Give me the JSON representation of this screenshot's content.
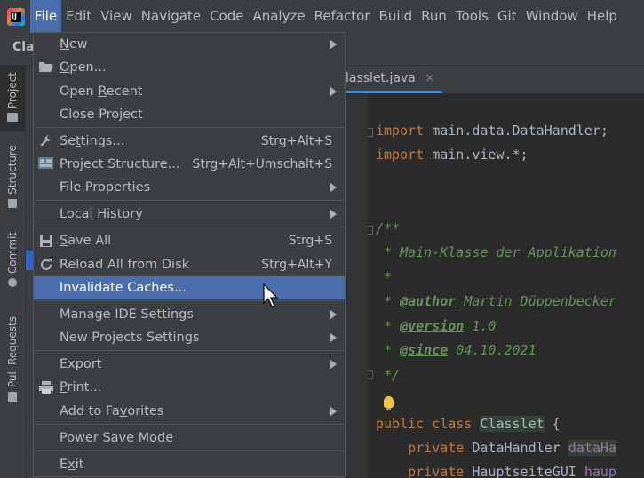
{
  "menubar": {
    "logo_text": "IJ",
    "items": [
      "File",
      "Edit",
      "View",
      "Navigate",
      "Code",
      "Analyze",
      "Refactor",
      "Build",
      "Run",
      "Tools",
      "Git",
      "Window",
      "Help"
    ],
    "active": "File"
  },
  "navbar": {
    "crumb": "Cla"
  },
  "toolstrip": {
    "tabs": [
      "Project",
      "Structure",
      "Commit",
      "Pull Requests"
    ]
  },
  "editor": {
    "tab_label": "lasslet.java",
    "tab_close": "×",
    "lines": [
      {
        "kw": "import",
        "rest": " main.data.DataHandler;"
      },
      {
        "kw": "import",
        "rest": " main.view.*;"
      },
      {
        "doc": "/**"
      },
      {
        "doc": " * Main-Klasse der Applikation"
      },
      {
        "doc": " *"
      },
      {
        "tag": "@author",
        "doc": " Martin Düppenbecker"
      },
      {
        "tag": "@version",
        "doc": " 1.0"
      },
      {
        "tag": "@since",
        "doc": " 04.10.2021"
      },
      {
        "doc": " */"
      },
      {
        "kw": "public class",
        "cls": "Classlet",
        "rest": " {"
      },
      {
        "kw": "private",
        "type": " DataHandler ",
        "fld": "dataHa"
      },
      {
        "kw": "private",
        "type": " HauptseiteGUI ",
        "fld": "haup"
      }
    ]
  },
  "file_menu": {
    "items": [
      {
        "label": "New",
        "mnemonic": "N",
        "shortcut": "",
        "submenu": true,
        "icon": ""
      },
      {
        "label": "Open...",
        "mnemonic": "O",
        "shortcut": "",
        "submenu": false,
        "icon": "folder-open-icon"
      },
      {
        "label": "Open Recent",
        "mnemonic": "R",
        "shortcut": "",
        "submenu": true,
        "icon": ""
      },
      {
        "label": "Close Project",
        "mnemonic": "",
        "shortcut": "",
        "submenu": false,
        "icon": ""
      },
      {
        "label": "Settings...",
        "mnemonic": "t",
        "shortcut": "Strg+Alt+S",
        "submenu": false,
        "icon": "wrench-icon"
      },
      {
        "label": "Project Structure...",
        "mnemonic": "",
        "shortcut": "Strg+Alt+Umschalt+S",
        "submenu": false,
        "icon": "project-structure-icon"
      },
      {
        "label": "File Properties",
        "mnemonic": "",
        "shortcut": "",
        "submenu": true,
        "icon": ""
      },
      {
        "label": "Local History",
        "mnemonic": "H",
        "shortcut": "",
        "submenu": true,
        "icon": ""
      },
      {
        "label": "Save All",
        "mnemonic": "S",
        "shortcut": "Strg+S",
        "submenu": false,
        "icon": "save-icon"
      },
      {
        "label": "Reload All from Disk",
        "mnemonic": "",
        "shortcut": "Strg+Alt+Y",
        "submenu": false,
        "icon": "reload-icon"
      },
      {
        "label": "Invalidate Caches...",
        "mnemonic": "",
        "shortcut": "",
        "submenu": false,
        "icon": "",
        "selected": true
      },
      {
        "label": "Manage IDE Settings",
        "mnemonic": "",
        "shortcut": "",
        "submenu": true,
        "icon": ""
      },
      {
        "label": "New Projects Settings",
        "mnemonic": "",
        "shortcut": "",
        "submenu": true,
        "icon": ""
      },
      {
        "label": "Export",
        "mnemonic": "",
        "shortcut": "",
        "submenu": true,
        "icon": ""
      },
      {
        "label": "Print...",
        "mnemonic": "P",
        "shortcut": "",
        "submenu": false,
        "icon": "print-icon"
      },
      {
        "label": "Add to Favorites",
        "mnemonic": "v",
        "shortcut": "",
        "submenu": true,
        "icon": ""
      },
      {
        "label": "Power Save Mode",
        "mnemonic": "",
        "shortcut": "",
        "submenu": false,
        "icon": ""
      },
      {
        "label": "Exit",
        "mnemonic": "x",
        "shortcut": "",
        "submenu": false,
        "icon": ""
      }
    ]
  },
  "colors": {
    "selection": "#4b6eaf",
    "menu_bg": "#3c3f41",
    "editor_bg": "#2b2b2b",
    "keyword": "#cc7832",
    "doc_comment": "#629755"
  }
}
